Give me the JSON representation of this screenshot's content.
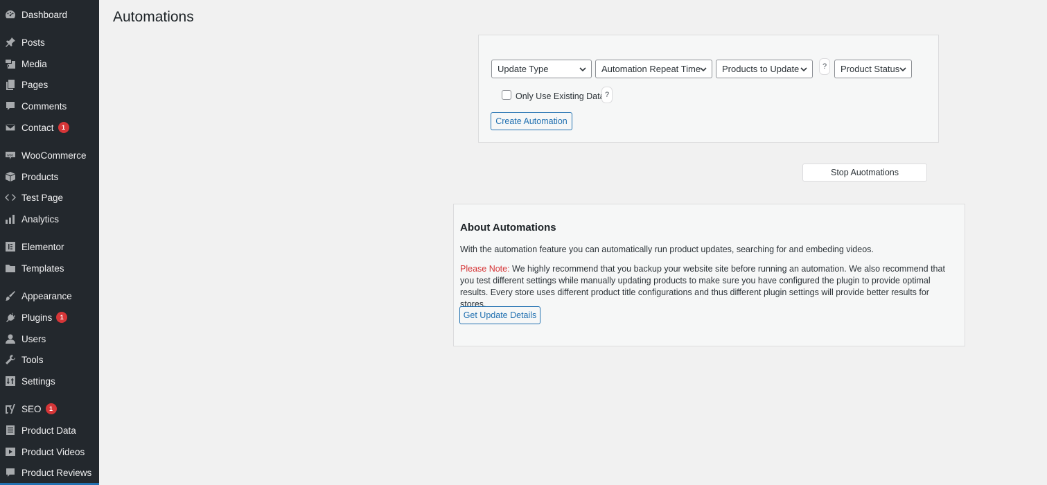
{
  "sidebar": {
    "items": [
      {
        "label": "Dashboard",
        "icon": "dashboard-icon"
      },
      {
        "label": "Posts",
        "icon": "pin-icon"
      },
      {
        "label": "Media",
        "icon": "media-icon"
      },
      {
        "label": "Pages",
        "icon": "pages-icon"
      },
      {
        "label": "Comments",
        "icon": "comment-icon"
      },
      {
        "label": "Contact",
        "icon": "envelope-icon",
        "badge": "1"
      },
      {
        "label": "WooCommerce",
        "icon": "woo-icon"
      },
      {
        "label": "Products",
        "icon": "box-icon"
      },
      {
        "label": "Test Page",
        "icon": "code-icon"
      },
      {
        "label": "Analytics",
        "icon": "bar-chart-icon"
      },
      {
        "label": "Elementor",
        "icon": "elementor-icon"
      },
      {
        "label": "Templates",
        "icon": "folder-icon"
      },
      {
        "label": "Appearance",
        "icon": "brush-icon"
      },
      {
        "label": "Plugins",
        "icon": "plug-icon",
        "badge": "1"
      },
      {
        "label": "Users",
        "icon": "user-icon"
      },
      {
        "label": "Tools",
        "icon": "wrench-icon"
      },
      {
        "label": "Settings",
        "icon": "sliders-icon"
      },
      {
        "label": "SEO",
        "icon": "yoast-icon",
        "badge": "1"
      },
      {
        "label": "Product Data",
        "icon": "document-icon"
      },
      {
        "label": "Product Videos",
        "icon": "video-icon"
      },
      {
        "label": "Product Reviews",
        "icon": "speech-icon"
      }
    ]
  },
  "main": {
    "title": "Automations",
    "automation_form": {
      "selects": [
        {
          "value": "Update Type"
        },
        {
          "value": "Automation Repeat Time"
        },
        {
          "value": "Products to Update"
        },
        {
          "value": "Product Status"
        }
      ],
      "help_label": "?",
      "checkbox_label": "Only Use Existing Data",
      "create_button": "Create Automation"
    },
    "stop_button": "Stop Auotmations",
    "about": {
      "title": "About Automations",
      "description": "With the automation feature you can automatically run product updates, searching for and embeding videos.",
      "note_label": "Please Note:",
      "note_text": " We highly recommend that you backup your website site before running an automation. We also recommend that you test different settings while manually updating products to make sure you have configured the plugin to provide optimal results. Every store uses different product title configurations and thus different plugin settings will provide better results for stores.",
      "details_button": "Get Update Details"
    }
  },
  "colors": {
    "sidebar_bg": "#23282d",
    "accent": "#2271b1",
    "badge": "#d63638",
    "note": "#d63638"
  }
}
